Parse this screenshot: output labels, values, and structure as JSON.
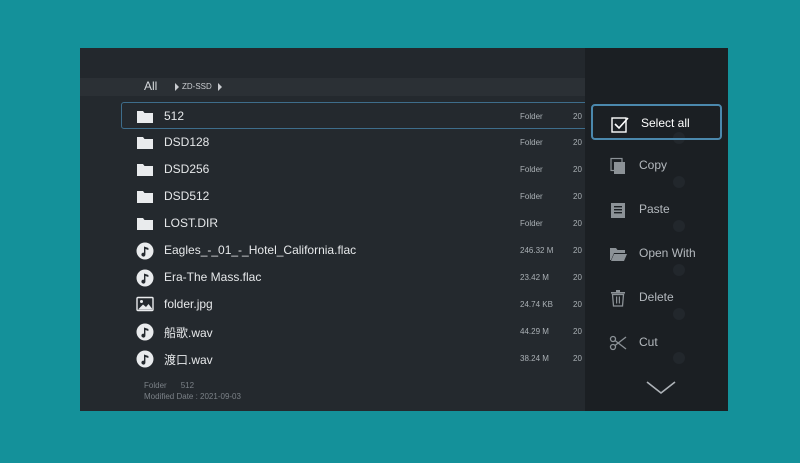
{
  "breadcrumb": {
    "all": "All",
    "segment": "ZD-SSD"
  },
  "files": [
    {
      "name": "512",
      "meta": "Folder",
      "date": "20",
      "type": "folder",
      "focused": true
    },
    {
      "name": "DSD128",
      "meta": "Folder",
      "date": "20",
      "type": "folder"
    },
    {
      "name": "DSD256",
      "meta": "Folder",
      "date": "20",
      "type": "folder"
    },
    {
      "name": "DSD512",
      "meta": "Folder",
      "date": "20",
      "type": "folder"
    },
    {
      "name": "LOST.DIR",
      "meta": "Folder",
      "date": "20",
      "type": "folder"
    },
    {
      "name": "Eagles_-_01_-_Hotel_California.flac",
      "meta": "246.32 M",
      "date": "20",
      "type": "audio"
    },
    {
      "name": "Era-The Mass.flac",
      "meta": "23.42 M",
      "date": "20",
      "type": "audio"
    },
    {
      "name": "folder.jpg",
      "meta": "24.74 KB",
      "date": "20",
      "type": "image"
    },
    {
      "name": "船歌.wav",
      "meta": "44.29 M",
      "date": "20",
      "type": "audio"
    },
    {
      "name": "渡口.wav",
      "meta": "38.24 M",
      "date": "20",
      "type": "audio"
    }
  ],
  "info": {
    "type_label": "Folder",
    "type_value": "512",
    "modified_label": "Modified Date : 2021-09-03"
  },
  "menu": [
    {
      "label": "Select all",
      "icon": "checkbox-icon",
      "selected": true
    },
    {
      "label": "Copy",
      "icon": "copy-icon"
    },
    {
      "label": "Paste",
      "icon": "paste-icon"
    },
    {
      "label": "Open With",
      "icon": "open-folder-icon"
    },
    {
      "label": "Delete",
      "icon": "trash-icon"
    },
    {
      "label": "Cut",
      "icon": "scissors-icon"
    }
  ],
  "colors": {
    "background": "#14919a",
    "screen": "#24292e",
    "panel": "#1b1f23",
    "focus": "#4b88ad"
  }
}
